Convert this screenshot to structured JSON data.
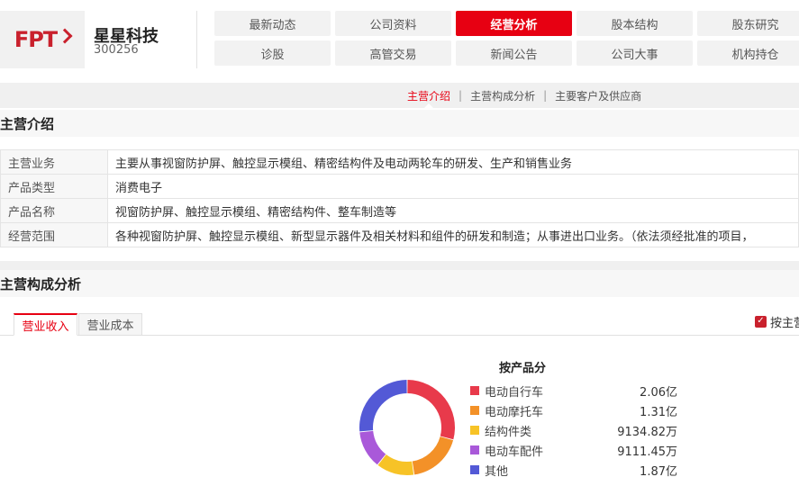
{
  "header": {
    "stock_name": "星星科技",
    "stock_code": "300256",
    "logo_text": "FPT"
  },
  "nav": {
    "items": [
      {
        "label": "最新动态",
        "active": false
      },
      {
        "label": "公司资料",
        "active": false
      },
      {
        "label": "经营分析",
        "active": true
      },
      {
        "label": "股本结构",
        "active": false
      },
      {
        "label": "股东研究",
        "active": false
      },
      {
        "label": "诊股",
        "active": false
      },
      {
        "label": "高管交易",
        "active": false
      },
      {
        "label": "新闻公告",
        "active": false
      },
      {
        "label": "公司大事",
        "active": false
      },
      {
        "label": "机构持仓",
        "active": false
      }
    ]
  },
  "subnav": {
    "items": [
      {
        "label": "主营介绍",
        "active": true
      },
      {
        "label": "主营构成分析",
        "active": false
      },
      {
        "label": "主要客户及供应商",
        "active": false
      }
    ],
    "separator": "|"
  },
  "intro": {
    "title": "主营介绍",
    "rows": [
      {
        "label": "主营业务",
        "value": "主要从事视窗防护屏、触控显示模组、精密结构件及电动两轮车的研发、生产和销售业务"
      },
      {
        "label": "产品类型",
        "value": "消费电子"
      },
      {
        "label": "产品名称",
        "value": "视窗防护屏、触控显示模组、精密结构件、整车制造等"
      },
      {
        "label": "经营范围",
        "value": "各种视窗防护屏、触控显示模组、新型显示器件及相关材料和组件的研发和制造；从事进出口业务。（依法须经批准的项目，"
      }
    ]
  },
  "composition": {
    "title": "主营构成分析",
    "tabs": [
      {
        "label": "营业收入",
        "active": true
      },
      {
        "label": "营业成本",
        "active": false
      }
    ],
    "checkbox_label": "按主营",
    "checkbox_mark": "✓"
  },
  "chart_data": {
    "type": "pie",
    "title": "按产品分",
    "donut": true,
    "categories": [
      "电动自行车",
      "电动摩托车",
      "结构件类",
      "电动车配件",
      "其他"
    ],
    "values": [
      20600,
      13100,
      9134.82,
      9111.45,
      18700
    ],
    "value_unit": "万",
    "value_labels": [
      "2.06亿",
      "1.31亿",
      "9134.82万",
      "9111.45万",
      "1.87亿"
    ],
    "colors": [
      "#e83a4b",
      "#f39128",
      "#f7c327",
      "#a959d9",
      "#5359d6"
    ],
    "legend_position": "right"
  }
}
